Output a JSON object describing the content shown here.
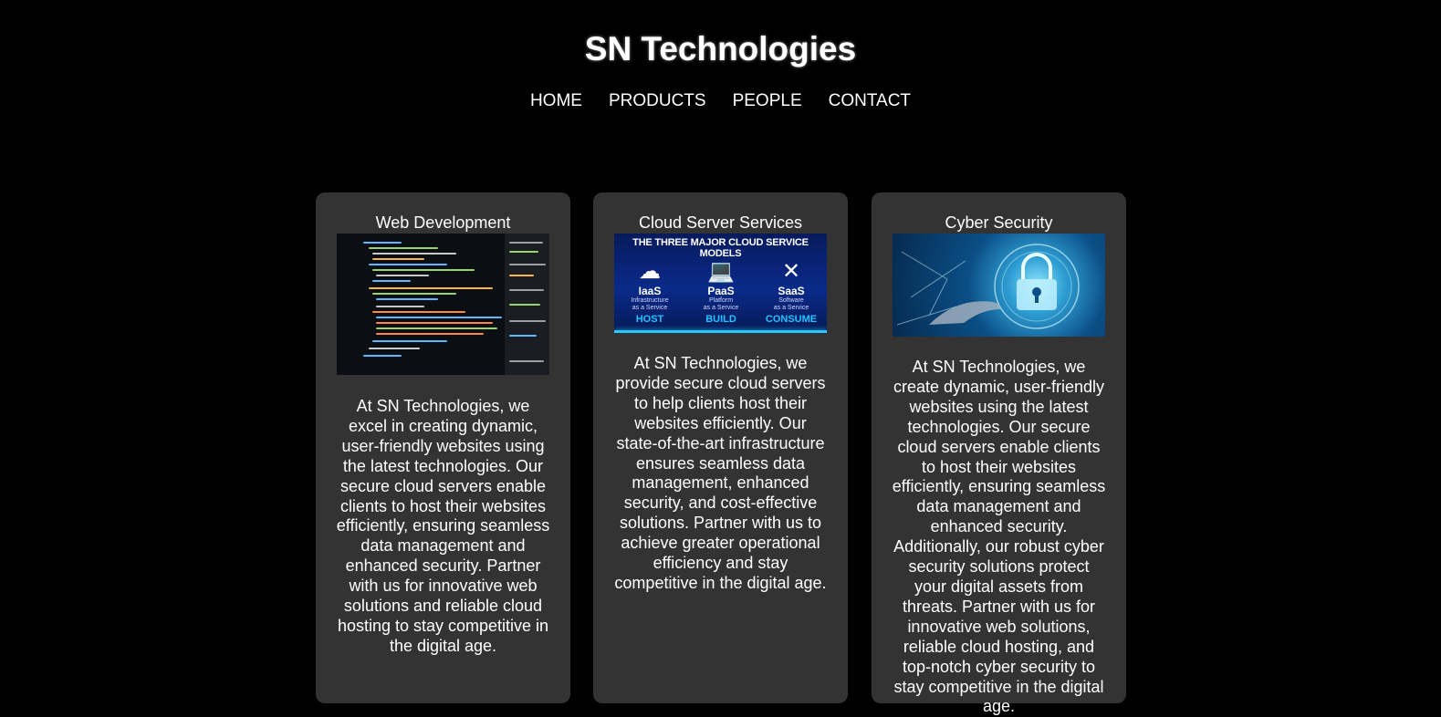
{
  "site": {
    "title": "SN Technologies"
  },
  "nav": {
    "items": [
      "HOME",
      "PRODUCTS",
      "PEOPLE",
      "CONTACT"
    ]
  },
  "cards": [
    {
      "title": "Web Development",
      "image_icon": "code-screen-icon",
      "text": "At SN Technologies, we excel in creating dynamic, user-friendly websites using the latest technologies. Our secure cloud servers enable clients to host their websites efficiently, ensuring seamless data management and enhanced security. Partner with us for innovative web solutions and reliable cloud hosting to stay competitive in the digital age."
    },
    {
      "title": "Cloud Server Services",
      "image": {
        "heading": "THE THREE MAJOR CLOUD SERVICE MODELS",
        "models": [
          {
            "abbr": "IaaS",
            "desc1": "Infrastructure",
            "desc2": "as a Service",
            "tag": "HOST",
            "icon": "cloud-upload-icon"
          },
          {
            "abbr": "PaaS",
            "desc1": "Platform",
            "desc2": "as a Service",
            "tag": "BUILD",
            "icon": "laptop-cloud-icon"
          },
          {
            "abbr": "SaaS",
            "desc1": "Software",
            "desc2": "as a Service",
            "tag": "CONSUME",
            "icon": "tools-icon"
          }
        ]
      },
      "text": "At SN Technologies, we provide secure cloud servers to help clients host their websites efficiently. Our state-of-the-art infrastructure ensures seamless data management, enhanced security, and cost-effective solutions. Partner with us to achieve greater operational efficiency and stay competitive in the digital age."
    },
    {
      "title": "Cyber Security",
      "image_icon": "padlock-icon",
      "text": "At SN Technologies, we create dynamic, user-friendly websites using the latest technologies. Our secure cloud servers enable clients to host their websites efficiently, ensuring seamless data management and enhanced security. Additionally, our robust cyber security solutions protect your digital assets from threats. Partner with us for innovative web solutions, reliable cloud hosting, and top-notch cyber security to stay competitive in the digital age."
    }
  ]
}
